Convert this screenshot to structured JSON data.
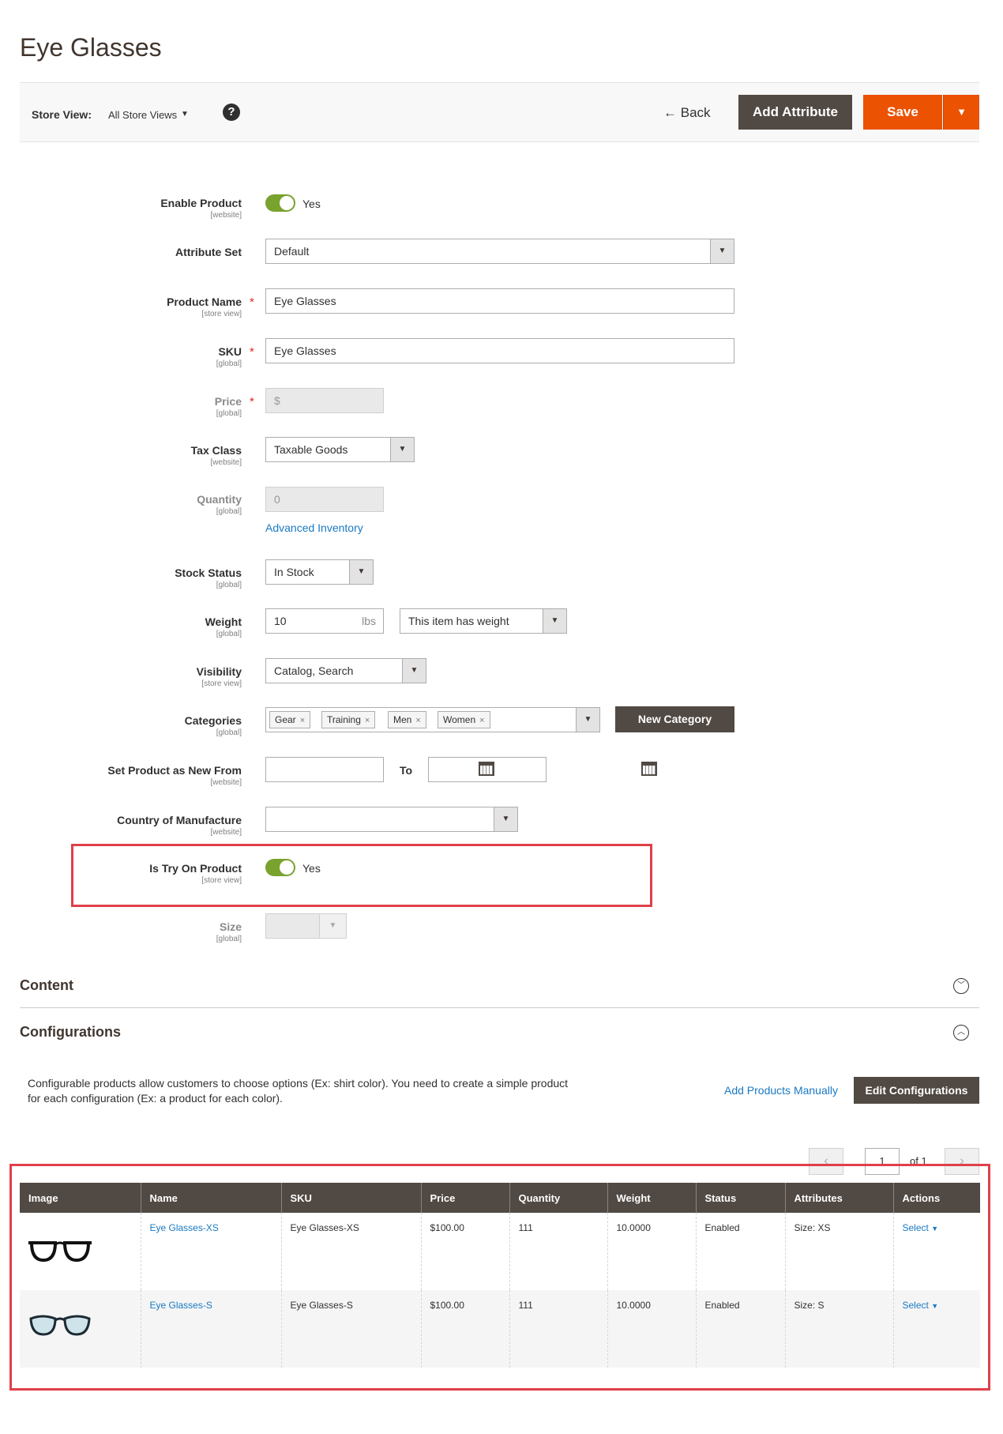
{
  "page": {
    "title": "Eye Glasses"
  },
  "toolbar": {
    "store_view_label": "Store View:",
    "store_view_value": "All Store Views",
    "help": "?",
    "back_label": "Back",
    "add_attribute_label": "Add Attribute",
    "save_label": "Save"
  },
  "form": {
    "enable_product": {
      "label": "Enable Product",
      "scope": "[website]",
      "value": "Yes"
    },
    "attribute_set": {
      "label": "Attribute Set",
      "value": "Default"
    },
    "product_name": {
      "label": "Product Name",
      "scope": "[store view]",
      "value": "Eye Glasses"
    },
    "sku": {
      "label": "SKU",
      "scope": "[global]",
      "value": "Eye Glasses"
    },
    "price": {
      "label": "Price",
      "scope": "[global]",
      "value": "$"
    },
    "tax_class": {
      "label": "Tax Class",
      "scope": "[website]",
      "value": "Taxable Goods"
    },
    "quantity": {
      "label": "Quantity",
      "scope": "[global]",
      "value": "0",
      "link": "Advanced Inventory"
    },
    "stock_status": {
      "label": "Stock Status",
      "scope": "[global]",
      "value": "In Stock"
    },
    "weight": {
      "label": "Weight",
      "scope": "[global]",
      "value": "10",
      "unit": "lbs",
      "type": "This item has weight"
    },
    "visibility": {
      "label": "Visibility",
      "scope": "[store view]",
      "value": "Catalog, Search"
    },
    "categories": {
      "label": "Categories",
      "scope": "[global]",
      "tags": [
        "Gear",
        "Training",
        "Men",
        "Women"
      ],
      "new_button": "New Category"
    },
    "new_from": {
      "label": "Set Product as New From",
      "scope": "[website]",
      "to_label": "To"
    },
    "country": {
      "label": "Country of Manufacture",
      "scope": "[website]",
      "value": ""
    },
    "try_on": {
      "label": "Is Try On Product",
      "scope": "[store view]",
      "value": "Yes"
    },
    "size": {
      "label": "Size",
      "scope": "[global]",
      "value": ""
    },
    "required_mark": "*"
  },
  "sections": {
    "content": "Content",
    "configurations": "Configurations"
  },
  "configurations": {
    "description_line1": "Configurable products allow customers to choose options (Ex: shirt color). You need to create a simple product",
    "description_line2": "for each configuration (Ex: a product for each color).",
    "add_manually": "Add Products Manually",
    "edit_button": "Edit Configurations",
    "pager": {
      "page": "1",
      "of": "of 1"
    },
    "columns": [
      "Image",
      "Name",
      "SKU",
      "Price",
      "Quantity",
      "Weight",
      "Status",
      "Attributes",
      "Actions"
    ],
    "rows": [
      {
        "name": "Eye Glasses-XS",
        "sku": "Eye Glasses-XS",
        "price": "$100.00",
        "quantity": "111",
        "weight": "10.0000",
        "status": "Enabled",
        "attributes": "Size: XS",
        "action": "Select"
      },
      {
        "name": "Eye Glasses-S",
        "sku": "Eye Glasses-S",
        "price": "$100.00",
        "quantity": "111",
        "weight": "10.0000",
        "status": "Enabled",
        "attributes": "Size: S",
        "action": "Select"
      }
    ]
  },
  "colors": {
    "accent": "#eb5202",
    "dark_button": "#514943",
    "link": "#1979c3",
    "toggle_on": "#79a22e",
    "highlight": "#e0404a"
  },
  "icons": [
    "help-icon",
    "back-arrow-icon",
    "chevron-down-icon",
    "calendar-icon",
    "expand-icon",
    "collapse-icon",
    "remove-tag-icon",
    "glasses-image-icon"
  ]
}
